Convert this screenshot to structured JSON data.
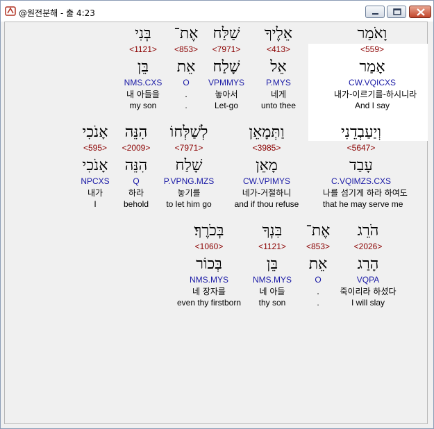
{
  "window": {
    "title": "@원전분해 - 출 4:23",
    "accent_color": "#c2462c"
  },
  "colors": {
    "number": "#8b0000",
    "code": "#1a1aa6",
    "text": "#000000",
    "highlight": "#ffffff"
  },
  "rows": [
    [
      {
        "heb1": "וָאֹמַר",
        "num": "<559>",
        "heb2": "אָמַר",
        "code": "CW.VQICXS",
        "kor": "내가-이르기를-하시니라",
        "eng": "And I say"
      },
      {
        "heb1": "אֵלֶיךָ",
        "num": "<413>",
        "heb2": "אֵל",
        "code": "P.MYS",
        "kor": "네게",
        "eng": "unto thee"
      },
      {
        "heb1": "שַׁלַּח",
        "num": "<7971>",
        "heb2": "שָׁלַח",
        "code": "VPMMYS",
        "kor": "놓아서",
        "eng": "Let-go"
      },
      {
        "heb1": "אֶת־",
        "num": "<853>",
        "heb2": "אֵת",
        "code": "O",
        "kor": ".",
        "eng": "."
      },
      {
        "heb1": "בְּנִי",
        "num": "<1121>",
        "heb2": "בֵּן",
        "code": "NMS.CXS",
        "kor": "내 아들을",
        "eng": "my son"
      }
    ],
    [
      {
        "heb1": "וְיַעַבְדֵנִי",
        "num": "<5647>",
        "heb2": "עָבַד",
        "code": "C.VQIMZS.CXS",
        "kor": "나를 섬기게 하라 하여도",
        "eng": "that he may serve me"
      },
      {
        "heb1": "וַתְּמָאֵן",
        "num": "<3985>",
        "heb2": "מָאֵן",
        "code": "CW.VPIMYS",
        "kor": "네가-거절하니",
        "eng": "and if thou refuse"
      },
      {
        "heb1": "לְשַׁלְּחוֹ",
        "num": "<7971>",
        "heb2": "שָׁלַח",
        "code": "P.VPNG.MZS",
        "kor": "놓기를",
        "eng": "to let him go"
      },
      {
        "heb1": "הִנֵּה",
        "num": "<2009>",
        "heb2": "הִנֵּה",
        "code": "Q",
        "kor": "하라",
        "eng": "behold"
      },
      {
        "heb1": "אָנֹכִי",
        "num": "<595>",
        "heb2": "אָנֹכִי",
        "code": "NPCXS",
        "kor": "내가",
        "eng": "I"
      }
    ],
    [
      {
        "heb1": "הֹרֵג",
        "num": "<2026>",
        "heb2": "הָרַג",
        "code": "VQPA",
        "kor": "죽이리라 하셨다",
        "eng": "I will slay"
      },
      {
        "heb1": "אֶת־",
        "num": "<853>",
        "heb2": "אֵת",
        "code": "O",
        "kor": ".",
        "eng": "."
      },
      {
        "heb1": "בִּנְךָ",
        "num": "<1121>",
        "heb2": "בֵּן",
        "code": "NMS.MYS",
        "kor": "네 아들",
        "eng": "thy son"
      },
      {
        "heb1": "בְּכֹרֶךָ׃",
        "num": "<1060>",
        "heb2": "בְּכוֹר",
        "code": "NMS.MYS",
        "kor": "네 장자를",
        "eng": "even thy firstborn"
      }
    ]
  ]
}
